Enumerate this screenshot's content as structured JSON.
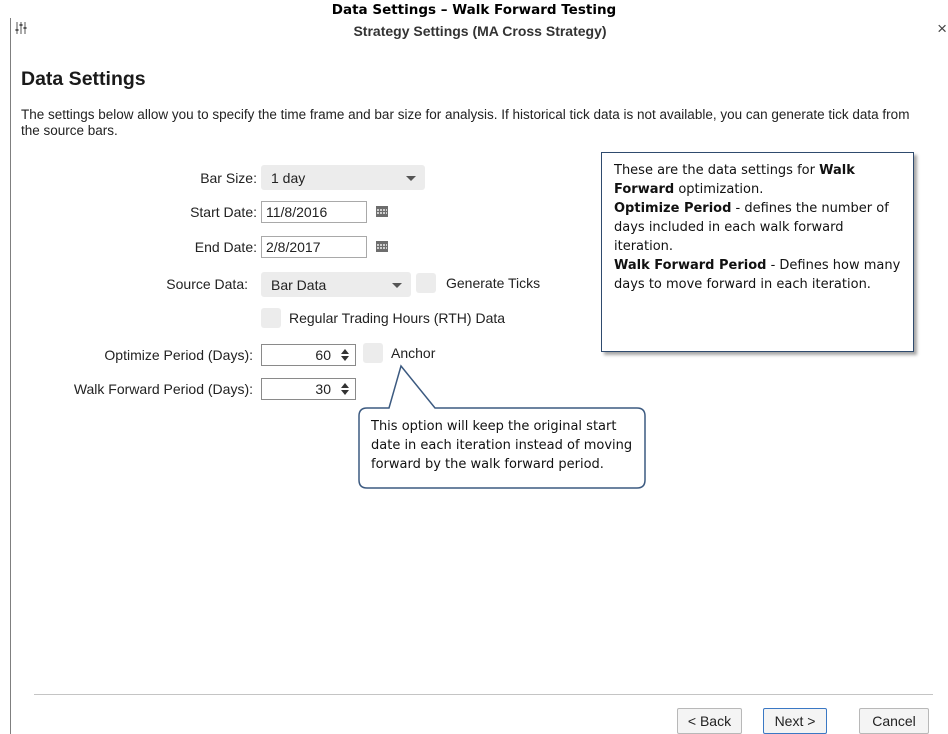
{
  "caption": "Data Settings – Walk Forward Testing",
  "window": {
    "title": "Strategy Settings (MA Cross Strategy)",
    "title_icon": "sliders-icon",
    "close_icon": "close-icon"
  },
  "heading": "Data Settings",
  "description": "The settings below allow you to specify the time frame and bar size for analysis.  If historical tick data is not available, you can generate tick data from the source bars.",
  "form": {
    "bar_size": {
      "label": "Bar Size:",
      "value": "1 day"
    },
    "start_date": {
      "label": "Start Date:",
      "value": "11/8/2016"
    },
    "end_date": {
      "label": "End Date:",
      "value": "2/8/2017"
    },
    "source_data": {
      "label": "Source Data:",
      "value": "Bar Data"
    },
    "generate_ticks": {
      "label": "Generate Ticks",
      "checked": false
    },
    "rth": {
      "label": "Regular Trading Hours (RTH) Data",
      "checked": false
    },
    "optimize_period": {
      "label": "Optimize Period (Days):",
      "value": "60"
    },
    "anchor": {
      "label": "Anchor",
      "checked": false
    },
    "walk_forward_period": {
      "label": "Walk Forward Period (Days):",
      "value": "30"
    }
  },
  "callout": {
    "line1_pre": "These are the data settings for ",
    "line1_bold": "Walk Forward",
    "line1_post": " optimization.",
    "line2_bold": "Optimize Period",
    "line2_post": " - defines the number of days included in each walk forward iteration.",
    "line3_bold": "Walk Forward Period",
    "line3_post": " - Defines how many days to move forward in each iteration."
  },
  "anchor_tip": "This option will keep the original start date in each iteration instead of moving forward by the walk forward period.",
  "buttons": {
    "back": "< Back",
    "next": "Next >",
    "cancel": "Cancel"
  },
  "colors": {
    "callout_border": "#2f4b6e",
    "primary_button_border": "#3a78c4",
    "control_bg": "#ececec"
  }
}
